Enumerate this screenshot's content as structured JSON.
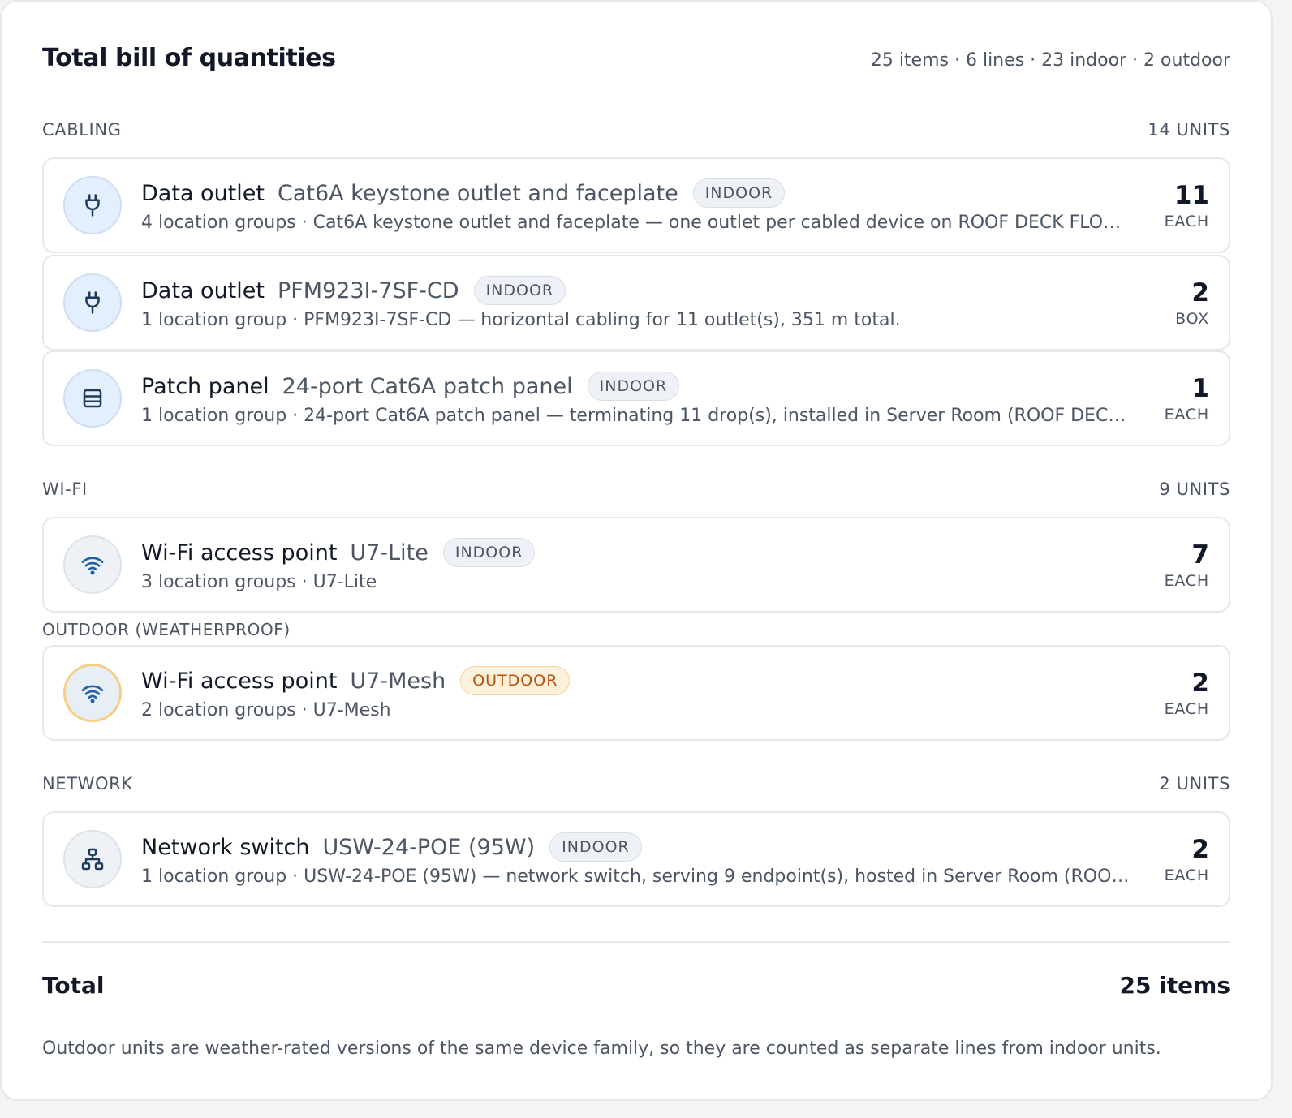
{
  "header": {
    "title": "Total bill of quantities",
    "summary": "25 items · 6 lines · 23 indoor · 2 outdoor"
  },
  "sections": {
    "cabling": {
      "label": "CABLING",
      "units": "14 UNITS",
      "items": [
        {
          "name": "Data outlet",
          "model": "Cat6A keystone outlet and faceplate",
          "badge": "INDOOR",
          "detail": "4 location groups · Cat6A keystone outlet and faceplate — one outlet per cabled device on ROOF DECK FLOOR.",
          "qty": "11",
          "unit": "EACH",
          "icon": "plug-icon"
        },
        {
          "name": "Data outlet",
          "model": "PFM923I-7SF-CD",
          "badge": "INDOOR",
          "detail": "1 location group · PFM923I-7SF-CD — horizontal cabling for 11 outlet(s), 351 m total.",
          "qty": "2",
          "unit": "BOX",
          "icon": "plug-icon"
        },
        {
          "name": "Patch panel",
          "model": "24-port Cat6A patch panel",
          "badge": "INDOOR",
          "detail": "1 location group · 24-port Cat6A patch panel — terminating 11 drop(s), installed in Server Room (ROOF DECK FLOOR).",
          "qty": "1",
          "unit": "EACH",
          "icon": "panel-icon"
        }
      ]
    },
    "wifi": {
      "label": "WI-FI",
      "units": "9 UNITS",
      "items": [
        {
          "name": "Wi-Fi access point",
          "model": "U7-Lite",
          "badge": "INDOOR",
          "detail": "3 location groups · U7-Lite",
          "qty": "7",
          "unit": "EACH",
          "icon": "wifi-icon"
        }
      ],
      "outdoor_label": "OUTDOOR (WEATHERPROOF)",
      "outdoor_items": [
        {
          "name": "Wi-Fi access point",
          "model": "U7-Mesh",
          "badge": "OUTDOOR",
          "detail": "2 location groups · U7-Mesh",
          "qty": "2",
          "unit": "EACH",
          "icon": "wifi-icon"
        }
      ]
    },
    "network": {
      "label": "NETWORK",
      "units": "2 UNITS",
      "items": [
        {
          "name": "Network switch",
          "model": "USW-24-POE (95W)",
          "badge": "INDOOR",
          "detail": "1 location group · USW-24-POE (95W) — network switch, serving 9 endpoint(s), hosted in Server Room (ROOF DECK FLOOR).",
          "qty": "2",
          "unit": "EACH",
          "icon": "network-icon"
        }
      ]
    }
  },
  "total": {
    "label": "Total",
    "value": "25 items"
  },
  "footnote": "Outdoor units are weather-rated versions of the same device family, so they are counted as separate lines from indoor units.",
  "colors": {
    "icon_blue": "#1f5fa6",
    "outdoor_badge": "#b45309",
    "outdoor_ring": "#f6cf86"
  }
}
